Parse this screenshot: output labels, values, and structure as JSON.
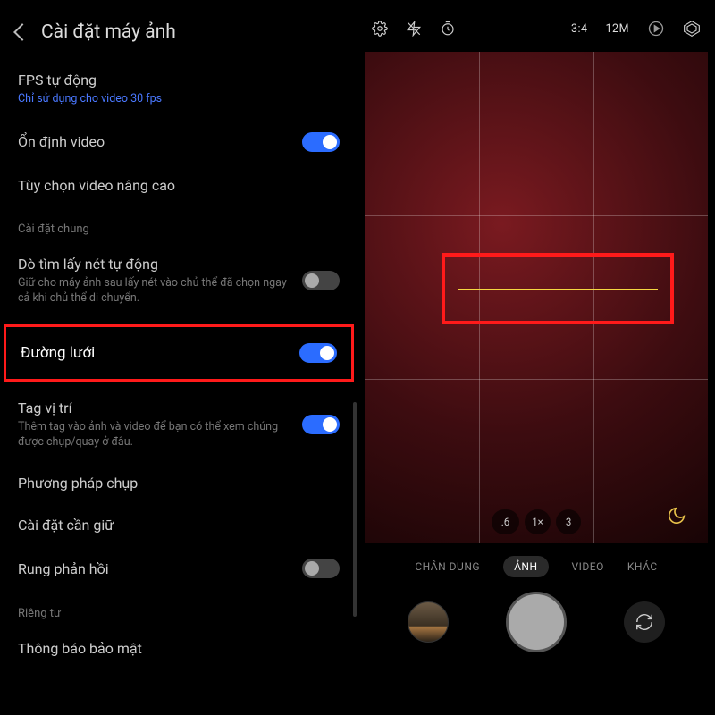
{
  "left": {
    "title": "Cài đặt máy ảnh",
    "items": {
      "fps": {
        "label": "FPS tự động",
        "sub": "Chỉ sử dụng cho video 30 fps"
      },
      "stab": {
        "label": "Ổn định video"
      },
      "adv": {
        "label": "Tùy chọn video nâng cao"
      }
    },
    "section_general": "Cài đặt chung",
    "general": {
      "af": {
        "label": "Dò tìm lấy nét tự động",
        "sub": "Giữ cho máy ảnh sau lấy nét vào chủ thể đã chọn ngay cả khi chủ thể di chuyển."
      },
      "grid": {
        "label": "Đường lưới"
      },
      "geo": {
        "label": "Tag vị trí",
        "sub": "Thêm tag vào ảnh và video để bạn có thể xem chúng được chụp/quay ở đâu."
      },
      "method": {
        "label": "Phương pháp chụp"
      },
      "keep": {
        "label": "Cài đặt cần giữ"
      },
      "haptic": {
        "label": "Rung phản hồi"
      }
    },
    "section_privacy": "Riêng tư",
    "privacy": {
      "notice": {
        "label": "Thông báo bảo mật"
      }
    }
  },
  "right": {
    "ratio": "3:4",
    "mp": "12M",
    "zoom": {
      "wide": ".6",
      "main": "1×",
      "tele": "3"
    },
    "modes": {
      "portrait": "CHÂN DUNG",
      "photo": "ẢNH",
      "video": "VIDEO",
      "more": "KHÁC"
    }
  }
}
